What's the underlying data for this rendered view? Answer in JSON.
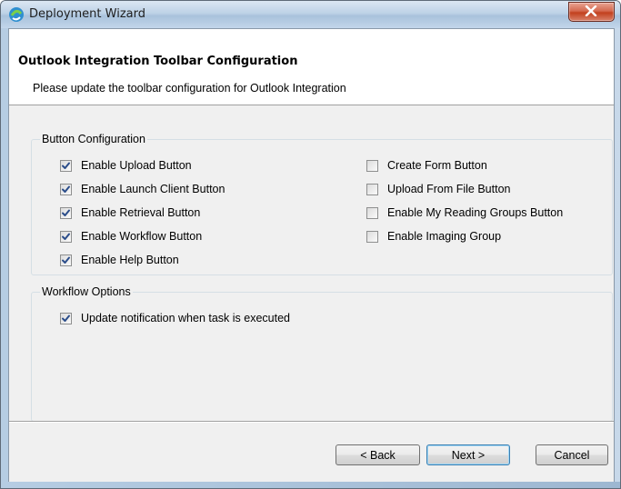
{
  "window": {
    "title": "Deployment Wizard",
    "accent_close": "#c2401d"
  },
  "header": {
    "title": "Outlook Integration Toolbar Configuration",
    "subtitle": "Please update the toolbar configuration for Outlook Integration"
  },
  "button_config": {
    "label": "Button Configuration",
    "left": [
      {
        "label": "Enable Upload Button",
        "checked": true
      },
      {
        "label": "Enable Launch Client Button",
        "checked": true
      },
      {
        "label": "Enable Retrieval Button",
        "checked": true
      },
      {
        "label": "Enable Workflow Button",
        "checked": true
      },
      {
        "label": "Enable Help Button",
        "checked": true
      }
    ],
    "right": [
      {
        "label": "Create Form Button",
        "checked": false
      },
      {
        "label": "Upload From File Button",
        "checked": false
      },
      {
        "label": "Enable My Reading Groups Button",
        "checked": false
      },
      {
        "label": "Enable Imaging Group",
        "checked": false
      }
    ]
  },
  "workflow_options": {
    "label": "Workflow Options",
    "items": [
      {
        "label": "Update notification when task is executed",
        "checked": true
      }
    ]
  },
  "footer": {
    "back_label": "< Back",
    "next_label": "Next >",
    "cancel_label": "Cancel"
  },
  "icons": {
    "app": "deployment-wizard-icon",
    "close": "close-icon",
    "check": "checkmark-icon"
  }
}
